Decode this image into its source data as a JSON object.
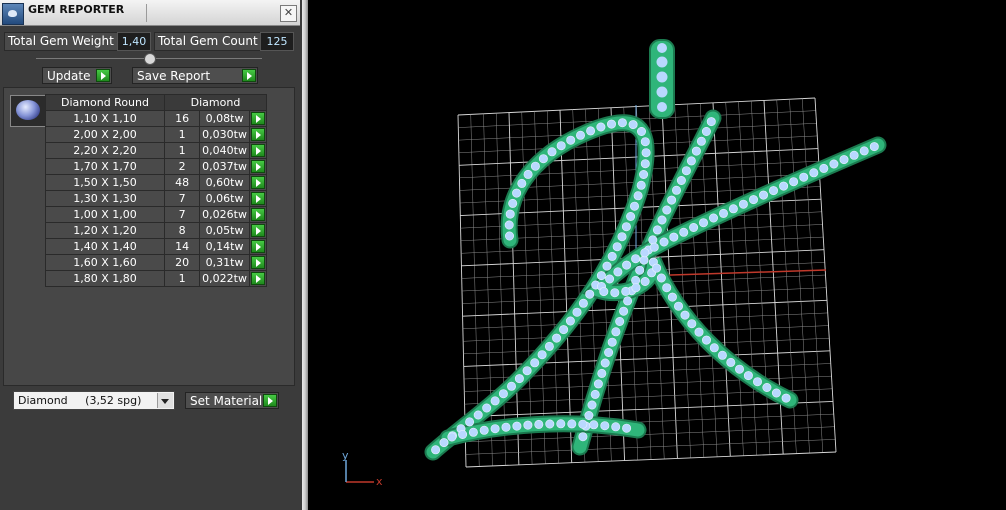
{
  "window": {
    "title": "GEM REPORTER",
    "close": "✕"
  },
  "summary": {
    "weight_label": "Total Gem Weight",
    "weight_value": "1,40",
    "count_label": "Total Gem Count",
    "count_value": "125"
  },
  "actions": {
    "update": "Update",
    "save_report": "Save Report"
  },
  "table": {
    "headers": [
      "Diamond Round",
      "Diamond"
    ],
    "rows": [
      {
        "size": "1,10 X 1,10",
        "count": "16",
        "weight": "0,08tw"
      },
      {
        "size": "2,00 X 2,00",
        "count": "1",
        "weight": "0,030tw"
      },
      {
        "size": "2,20 X 2,20",
        "count": "1",
        "weight": "0,040tw"
      },
      {
        "size": "1,70 X 1,70",
        "count": "2",
        "weight": "0,037tw"
      },
      {
        "size": "1,50 X 1,50",
        "count": "48",
        "weight": "0,60tw"
      },
      {
        "size": "1,30 X 1,30",
        "count": "7",
        "weight": "0,06tw"
      },
      {
        "size": "1,00 X 1,00",
        "count": "7",
        "weight": "0,026tw"
      },
      {
        "size": "1,20 X 1,20",
        "count": "8",
        "weight": "0,05tw"
      },
      {
        "size": "1,40 X 1,40",
        "count": "14",
        "weight": "0,14tw"
      },
      {
        "size": "1,60 X 1,60",
        "count": "20",
        "weight": "0,31tw"
      },
      {
        "size": "1,80 X 1,80",
        "count": "1",
        "weight": "0,022tw"
      }
    ]
  },
  "material": {
    "selected": "Diamond     (3,52 spg)",
    "set_label": "Set Material"
  },
  "viewport": {
    "axis_y": "y",
    "axis_x": "x",
    "colors": {
      "background": "#000000",
      "grid": "#c8c8c8",
      "metal": "#2fb57a",
      "gem": "#b9d8ff",
      "axis_x": "#c0392b",
      "axis_y": "#6fa8dc"
    }
  }
}
